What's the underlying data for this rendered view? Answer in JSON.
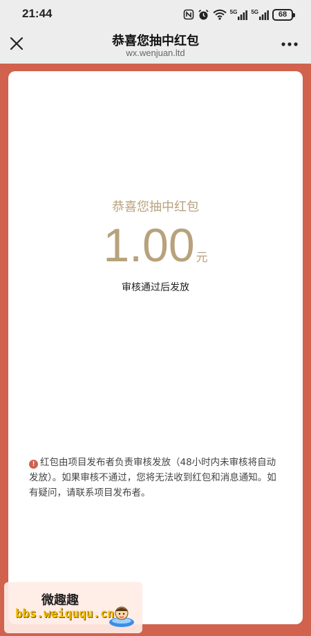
{
  "status_bar": {
    "time": "21:44",
    "network_1": "5G",
    "network_2": "5G",
    "battery": "68",
    "icons": [
      "nfc-icon",
      "alarm-icon",
      "wifi-icon",
      "signal-icon",
      "signal-icon",
      "battery-icon"
    ]
  },
  "nav": {
    "title": "恭喜您抽中红包",
    "subtitle": "wx.wenjuan.ltd",
    "close_icon": "close-icon",
    "more_icon": "more-icon"
  },
  "card": {
    "title": "恭喜您抽中红包",
    "amount": "1.00",
    "unit": "元",
    "status": "审核通过后发放"
  },
  "notice": {
    "icon": "!",
    "text": "红包由项目发布者负责审核发放（48小时内未审核将自动发放）。如果审核不通过，您将无法收到红包和消息通知。如有疑问，请联系项目发布者。"
  },
  "watermark": {
    "title": "微趣趣",
    "url": "bbs.weiququ.cn"
  },
  "colors": {
    "accent_red": "#d0624e",
    "gold_text": "#b7a27d",
    "background": "#ededed"
  }
}
